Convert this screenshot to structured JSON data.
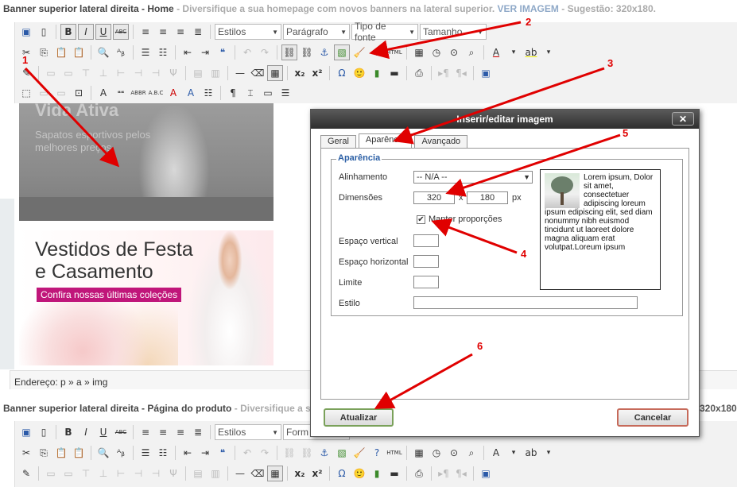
{
  "section1": {
    "title": "Banner superior lateral direita - Home",
    "desc": "- Diversifique a sua homepage com novos banners na lateral superior.",
    "link": "VER IMAGEM",
    "suggest": "- Sugestão: 320x180."
  },
  "section2": {
    "title": "Banner superior lateral direita - Página do produto",
    "desc": "- Diversifique a sua",
    "suggest": "320x180."
  },
  "toolbar": {
    "styles_label": "Estilos",
    "format_label": "Parágrafo",
    "format_label_2": "Form",
    "font_label": "Tipo de fonte",
    "size_label": "Tamanho"
  },
  "editor": {
    "banner1_title": "Vida Ativa",
    "banner1_sub": "Sapatos esportivos pelos melhores preços",
    "banner2_title": "Vestidos de Festa e Casamento",
    "banner2_cta": "Confira nossas últimas coleções",
    "address": "Endereço: p » a » img"
  },
  "dialog": {
    "title": "Inserir/editar imagem",
    "close": "✕",
    "tabs": [
      "Geral",
      "Aparência",
      "Avançado"
    ],
    "active_tab": "Aparência",
    "legend": "Aparência",
    "align_label": "Alinhamento",
    "align_value": "-- N/A --",
    "dims_label": "Dimensões",
    "width": "320",
    "x_sep": "x",
    "height": "180",
    "unit": "px",
    "keep_ratio": "Manter proporções",
    "vspace_label": "Espaço vertical",
    "hspace_label": "Espaço horizontal",
    "border_label": "Limite",
    "style_label": "Estilo",
    "preview_text": "Lorem ipsum, Dolor sit amet, consectetuer adipiscing loreum ipsum edipiscing elit, sed diam nonummy nibh euismod tincidunt ut laoreet dolore magna aliquam erat volutpat.Loreum ipsum",
    "update_button": "Atualizar",
    "cancel_button": "Cancelar"
  },
  "annotations": [
    "1",
    "2",
    "3",
    "4",
    "5",
    "6"
  ],
  "colors": {
    "annotation_red": "#e00000",
    "cta_magenta": "#c0167a",
    "legend_blue": "#2b5fa5"
  }
}
